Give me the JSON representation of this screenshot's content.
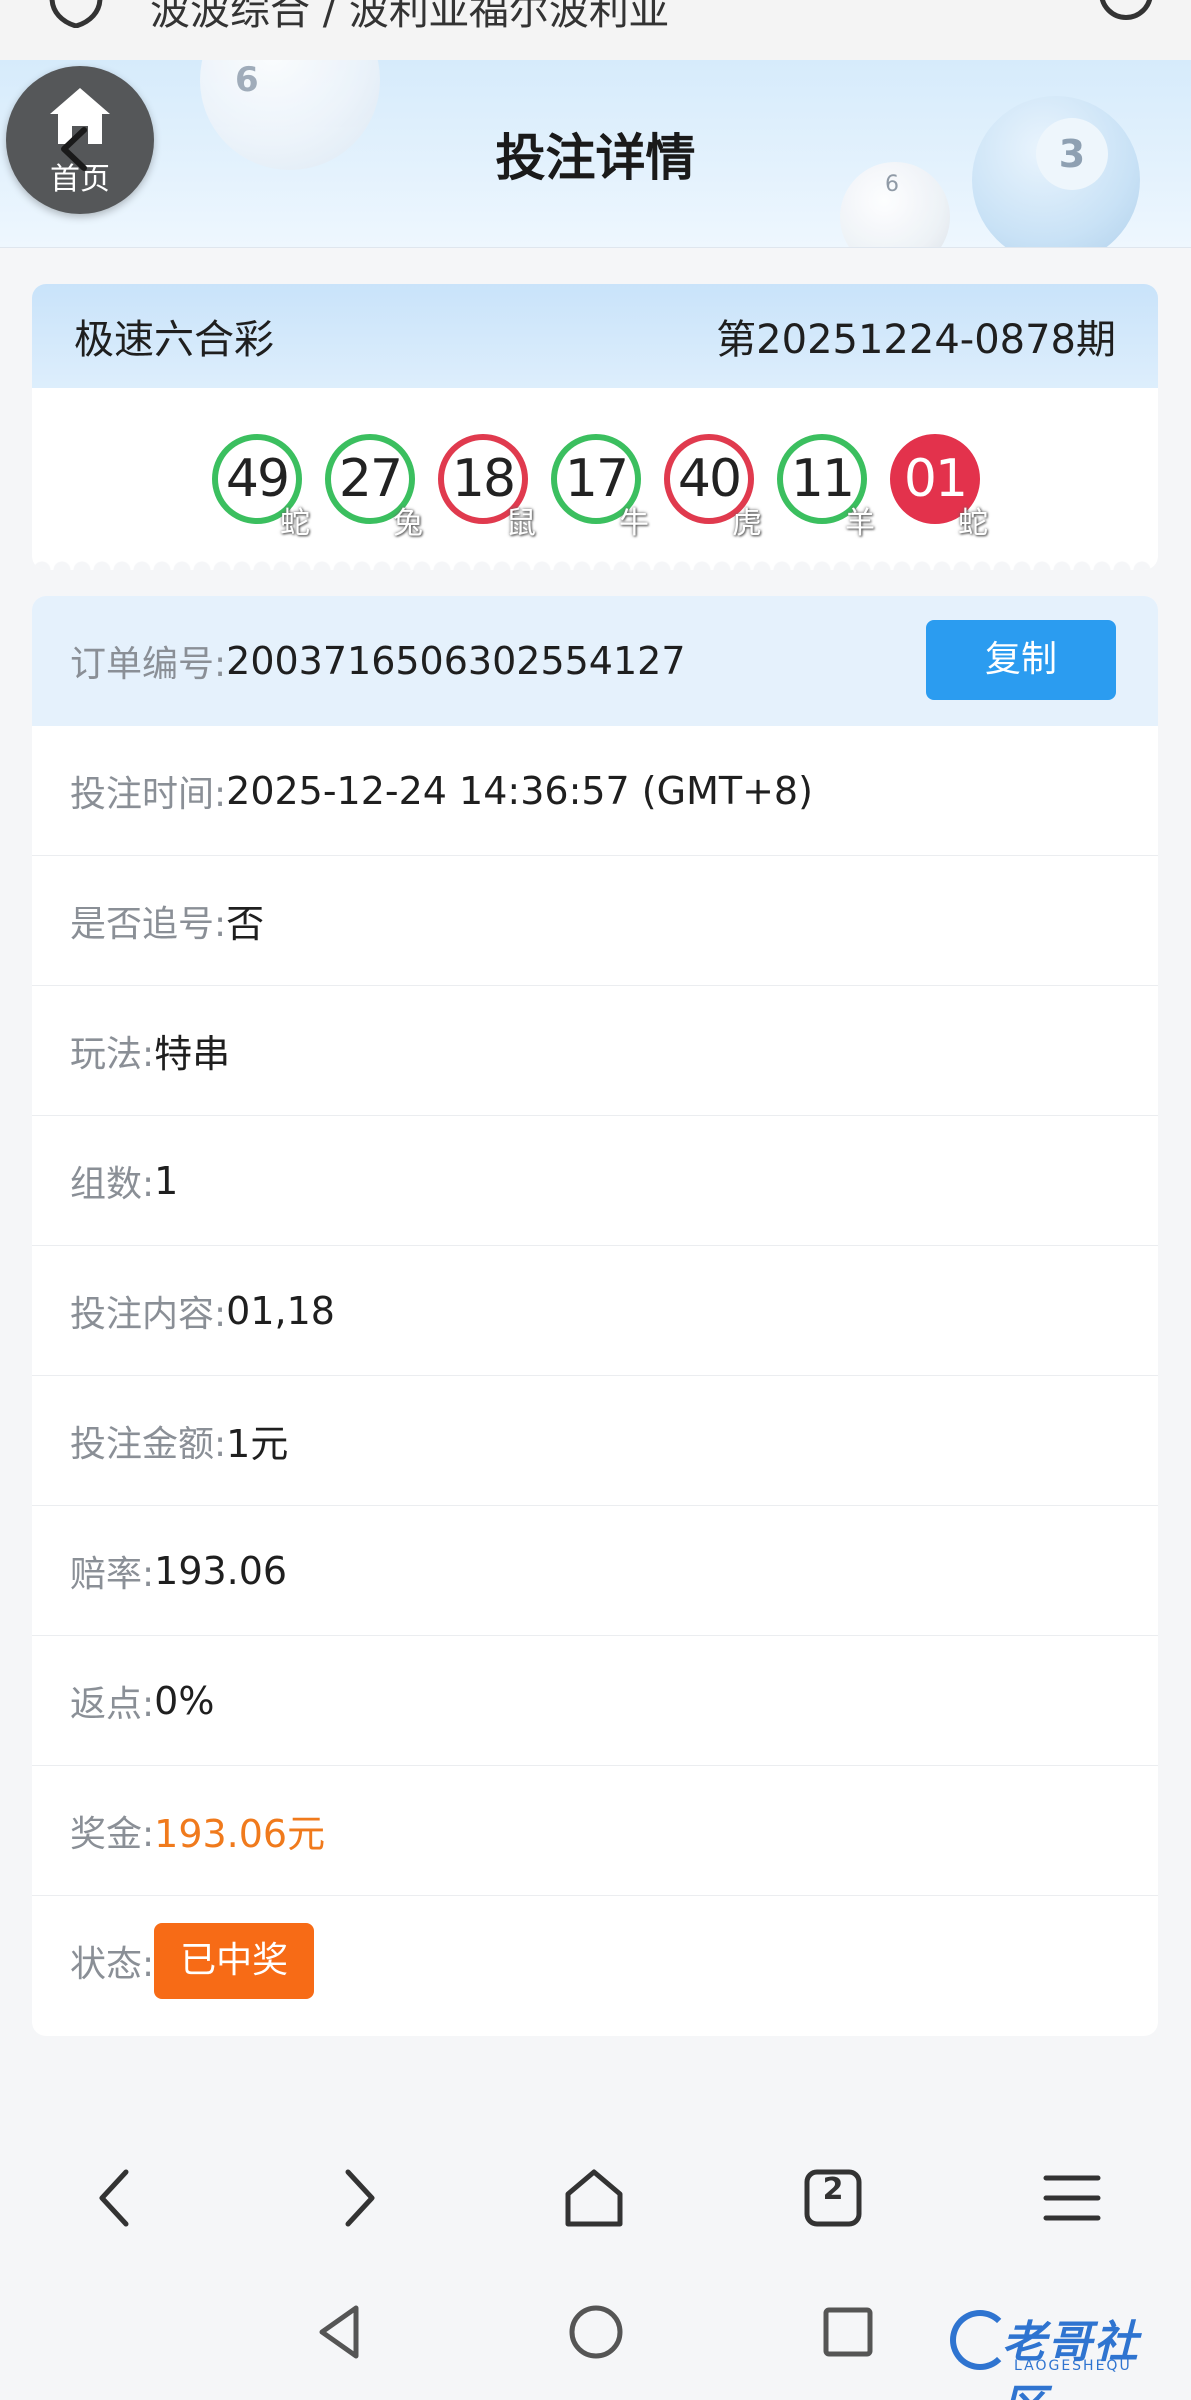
{
  "browser": {
    "url_text": "波波综合 / 波利亚福尔波利亚"
  },
  "header": {
    "title": "投注详情",
    "home_label": "首页",
    "deco_numbers": [
      "6",
      "6",
      "3"
    ]
  },
  "draw": {
    "game_name": "极速六合彩",
    "period": "第20251224-0878期",
    "balls": [
      {
        "number": "49",
        "zodiac": "蛇",
        "color": "green",
        "style": "ring"
      },
      {
        "number": "27",
        "zodiac": "兔",
        "color": "green",
        "style": "ring"
      },
      {
        "number": "18",
        "zodiac": "鼠",
        "color": "red",
        "style": "ring"
      },
      {
        "number": "17",
        "zodiac": "牛",
        "color": "green",
        "style": "ring"
      },
      {
        "number": "40",
        "zodiac": "虎",
        "color": "red",
        "style": "ring"
      },
      {
        "number": "11",
        "zodiac": "羊",
        "color": "green",
        "style": "ring"
      },
      {
        "number": "01",
        "zodiac": "蛇",
        "color": "red",
        "style": "solid"
      }
    ]
  },
  "order": {
    "order_no_label": "订单编号:",
    "order_no": "2003716506302554127",
    "copy_label": "复制",
    "bet_time_label": "投注时间:",
    "bet_time": "2025-12-24 14:36:57 (GMT+8)",
    "chase_label": "是否追号:",
    "chase": "否",
    "play_label": "玩法:",
    "play": "特串",
    "groups_label": "组数:",
    "groups": "1",
    "content_label": "投注内容:",
    "content": "01,18",
    "amount_label": "投注金额:",
    "amount": "1元",
    "odds_label": "赔率:",
    "odds": "193.06",
    "rebate_label": "返点:",
    "rebate": "0%",
    "prize_label": "奖金:",
    "prize": "193.06元",
    "status_label": "状态:",
    "status": "已中奖"
  },
  "browser_nav": {
    "tab_count": "2"
  },
  "watermark": {
    "text": "老哥社区",
    "sub": "LAOGESHEQU"
  },
  "colors": {
    "accent_blue": "#2b9cf0",
    "ball_green": "#3bbf5f",
    "ball_red": "#e03a4e",
    "prize_orange": "#f07a1c",
    "status_orange": "#f76b16"
  }
}
